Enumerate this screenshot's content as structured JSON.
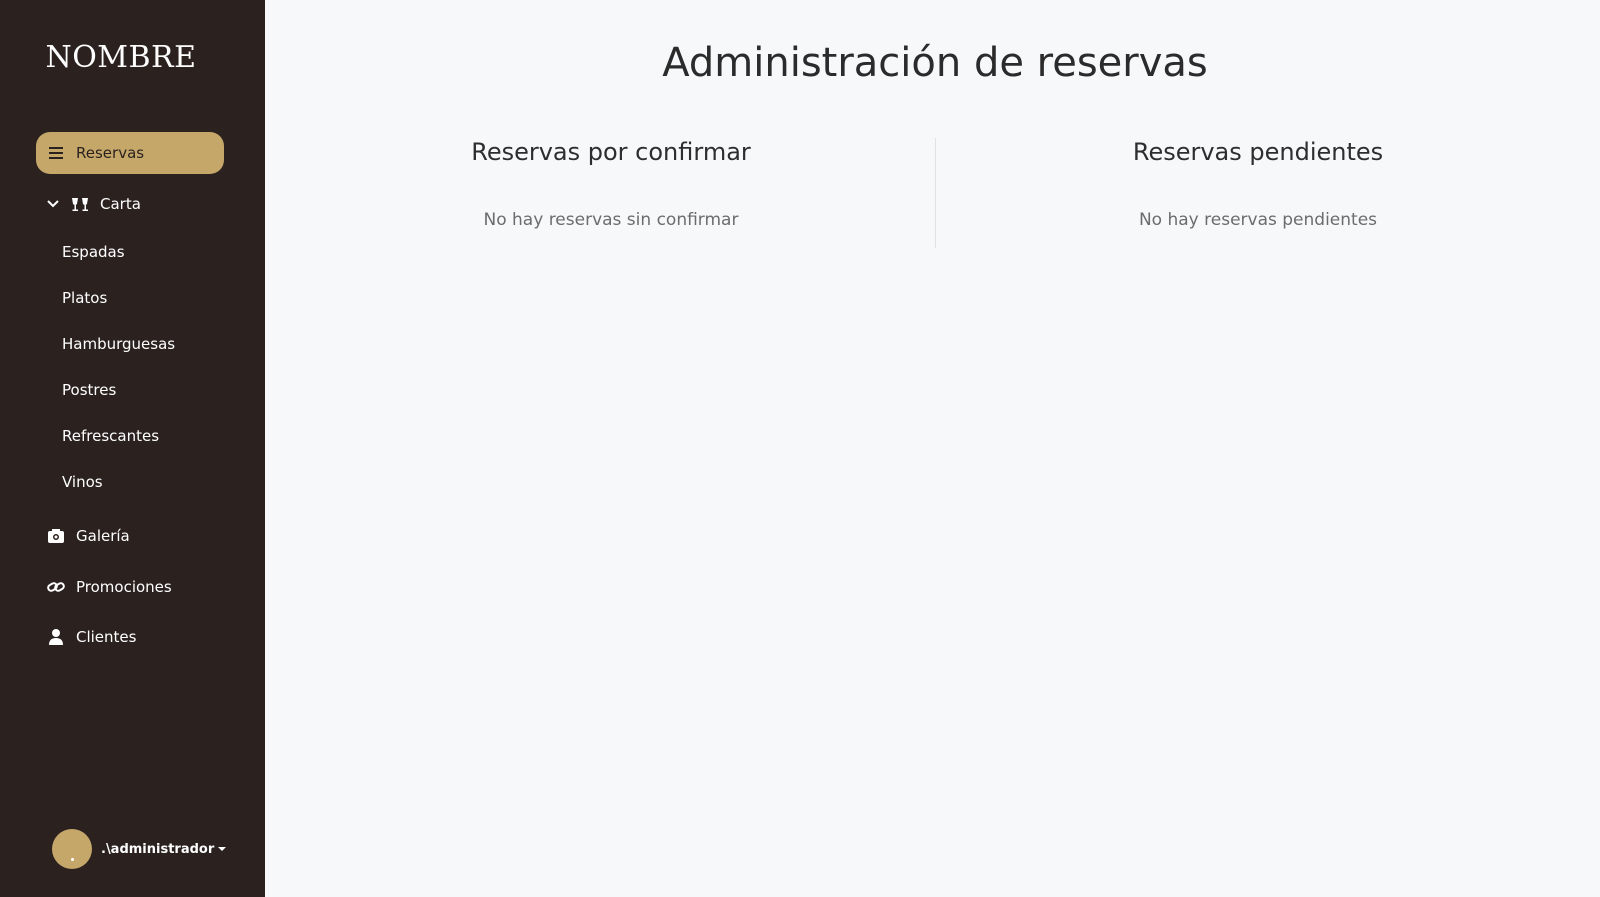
{
  "sidebar": {
    "brand": "NOMBRE",
    "nav": {
      "reservas": "Reservas",
      "carta": "Carta",
      "carta_items": [
        "Espadas",
        "Platos",
        "Hamburguesas",
        "Postres",
        "Refrescantes",
        "Vinos"
      ],
      "galeria": "Galería",
      "promociones": "Promociones",
      "clientes": "Clientes"
    },
    "user": {
      "name": ".\\administrador"
    }
  },
  "main": {
    "title": "Administración de reservas",
    "columns": [
      {
        "heading": "Reservas por confirmar",
        "empty_text": "No hay reservas sin confirmar"
      },
      {
        "heading": "Reservas pendientes",
        "empty_text": "No hay reservas pendientes"
      }
    ]
  },
  "colors": {
    "sidebar_bg": "#2b2220",
    "accent": "#c5a76a",
    "page_bg": "#f7f8fa"
  }
}
